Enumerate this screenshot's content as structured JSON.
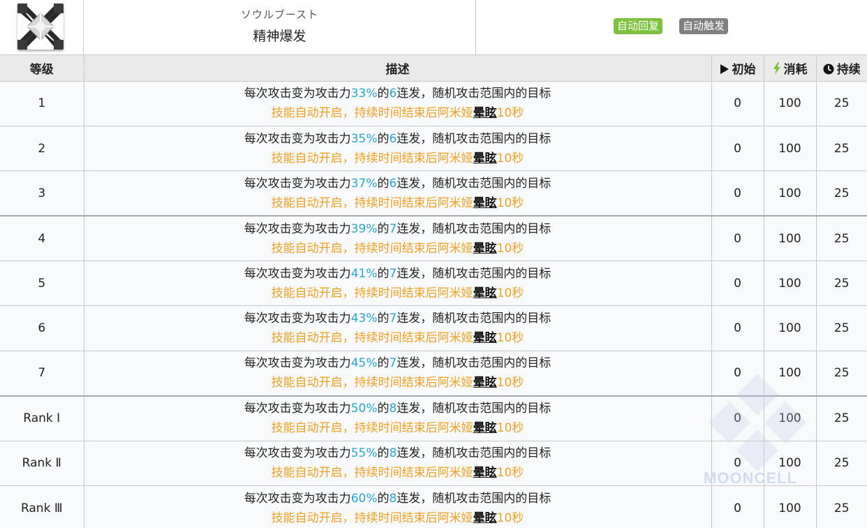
{
  "header": {
    "subtitle": "ソウルブースト",
    "title": "精神爆发",
    "icon": "skill-cross-icon",
    "badges": [
      "自动回复",
      "自动触发"
    ],
    "badge_colors": {
      "green": "#7cc23e",
      "gray": "#808080"
    }
  },
  "columns": {
    "level": "等级",
    "description": "描述",
    "initial": "初始",
    "cost": "消耗",
    "duration": "持续"
  },
  "colors": {
    "number": "#28a8d8",
    "line2": "#f0a020"
  },
  "text": {
    "l1_a": "每次攻击变为攻击力",
    "l1_b": "的",
    "l1_c": "连发，随机攻击范围内的目标",
    "l2_a": "技能自动开启，持续时间结束后阿米娅",
    "stun": "晕眩",
    "l2_b": "10秒"
  },
  "rows": [
    {
      "level": "1",
      "atk": "33%",
      "hits": "6",
      "initial": "0",
      "cost": "100",
      "duration": "25"
    },
    {
      "level": "2",
      "atk": "35%",
      "hits": "6",
      "initial": "0",
      "cost": "100",
      "duration": "25"
    },
    {
      "level": "3",
      "atk": "37%",
      "hits": "6",
      "initial": "0",
      "cost": "100",
      "duration": "25"
    },
    {
      "level": "4",
      "atk": "39%",
      "hits": "7",
      "initial": "0",
      "cost": "100",
      "duration": "25"
    },
    {
      "level": "5",
      "atk": "41%",
      "hits": "7",
      "initial": "0",
      "cost": "100",
      "duration": "25"
    },
    {
      "level": "6",
      "atk": "43%",
      "hits": "7",
      "initial": "0",
      "cost": "100",
      "duration": "25"
    },
    {
      "level": "7",
      "atk": "45%",
      "hits": "7",
      "initial": "0",
      "cost": "100",
      "duration": "25"
    },
    {
      "level": "Rank Ⅰ",
      "atk": "50%",
      "hits": "8",
      "initial": "0",
      "cost": "100",
      "duration": "25"
    },
    {
      "level": "Rank Ⅱ",
      "atk": "55%",
      "hits": "8",
      "initial": "0",
      "cost": "100",
      "duration": "25"
    },
    {
      "level": "Rank Ⅲ",
      "atk": "60%",
      "hits": "8",
      "initial": "0",
      "cost": "100",
      "duration": "25"
    }
  ],
  "watermark": "MOONCELL"
}
